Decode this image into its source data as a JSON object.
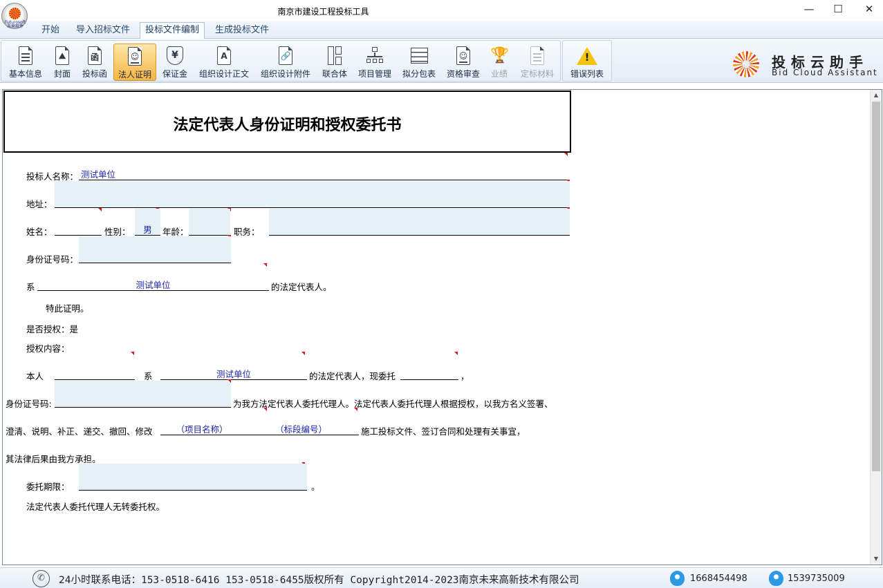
{
  "window": {
    "title": "南京市建设工程投标工具",
    "logo_text": "Futurosoft 未来软件"
  },
  "menu": {
    "tabs": [
      {
        "label": "开始"
      },
      {
        "label": "导入招标文件"
      },
      {
        "label": "投标文件编制"
      },
      {
        "label": "生成投标文件"
      }
    ],
    "active_index": 2
  },
  "toolbar": {
    "buttons": [
      {
        "label": "基本信息",
        "icon": "document-lines-icon"
      },
      {
        "label": "封面",
        "icon": "cover-image-icon"
      },
      {
        "label": "投标函",
        "icon": "bid-letter-icon"
      },
      {
        "label": "法人证明",
        "icon": "person-id-icon"
      },
      {
        "label": "保证金",
        "icon": "yen-shield-icon"
      },
      {
        "label": "组织设计正文",
        "icon": "document-a-icon"
      },
      {
        "label": "组织设计附件",
        "icon": "attachment-icon"
      },
      {
        "label": "联合体",
        "icon": "union-blocks-icon"
      },
      {
        "label": "项目管理",
        "icon": "org-chart-icon"
      },
      {
        "label": "拟分包表",
        "icon": "table-grid-icon"
      },
      {
        "label": "资格审查",
        "icon": "person-check-icon"
      },
      {
        "label": "业绩",
        "icon": "trophy-icon"
      },
      {
        "label": "定标材料",
        "icon": "material-doc-icon"
      },
      {
        "label": "错误列表",
        "icon": "warning-icon"
      }
    ],
    "active_label": "法人证明",
    "disabled_labels": [
      "业绩",
      "定标材料"
    ]
  },
  "brand": {
    "cn": "投标云助手",
    "en": "Bid Cloud Assistant"
  },
  "document": {
    "title": "法定代表人身份证明和授权委托书",
    "bidder_label": "投标人名称：",
    "bidder_value": "测试单位",
    "address_label": "地址：",
    "address_value": "",
    "name_label": "姓名：",
    "name_value": "",
    "gender_label": "性别：",
    "gender_value": "男",
    "age_label": "年龄：",
    "age_value": "",
    "position_label": "职务：",
    "position_value": "",
    "id_label": "身份证号码：",
    "id_value": "",
    "belong_prefix": "系",
    "belong_value": "测试单位",
    "belong_suffix": "的法定代表人。",
    "certify_text": "特此证明。",
    "authorized_text": "是否授权：是",
    "auth_content_label": "授权内容：",
    "self_label": "本人",
    "self_value": "",
    "self_belong_label": "系",
    "self_belong_value": "测试单位",
    "entrust_text": "的法定代表人，现委托",
    "entrust_value": "",
    "comma": "，",
    "agent_id_label": "身份证号码:",
    "agent_id_value": "",
    "agent_text": "为我方法定代表人委托代理人。法定代表人委托代理人根据授权，以我方名义签署、",
    "clarify_text": "澄清、说明、补正、递交、撤回、修改",
    "project_name": "（项目名称）",
    "section_no": "（标段编号）",
    "construction_text": "施工投标文件、签订合同和处理有关事宜，",
    "legal_text": "其法律后果由我方承担。",
    "period_label": "委托期限：",
    "period_value": "",
    "period_end": "。",
    "no_transfer_text": "法定代表人委托代理人无转委托权。"
  },
  "statusbar": {
    "contact": "24小时联系电话：153-0518-6416 153-0518-6455版权所有 Copyright2014-2023南京未来高新技术有限公司",
    "qq1": "1668454498",
    "qq2": "1539735009"
  }
}
